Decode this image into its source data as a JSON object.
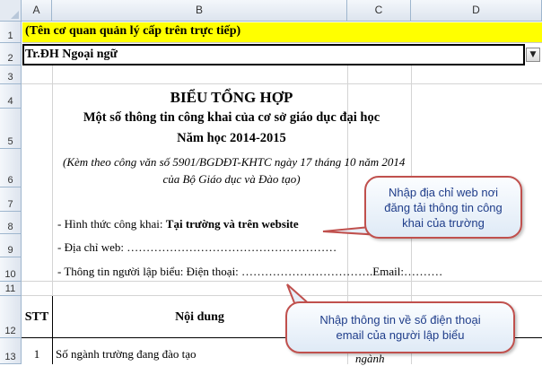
{
  "columns": [
    "A",
    "B",
    "C",
    "D"
  ],
  "rows": [
    "1",
    "2",
    "3",
    "4",
    "5",
    "6",
    "7",
    "8",
    "9",
    "10",
    "11",
    "12",
    "13"
  ],
  "row1": {
    "text": "(Tên cơ quan quản lý cấp trên trực tiếp)",
    "fill": "#ffff00"
  },
  "row2": {
    "text": "Tr.ĐH  Ngoại ngữ"
  },
  "title": {
    "heading": "BIỂU TỔNG HỢP",
    "subheading": "Một số thông tin công khai của cơ sở giáo dục đại học",
    "year": "Năm học 2014-2015",
    "note_line1": "(Kèm theo công văn số 5901/BGDĐT-KHTC  ngày 17 tháng 10 năm 2014",
    "note_line2": "của Bộ Giáo dục và Đào tạo)"
  },
  "form": {
    "publication_prefix": "- Hình thức công khai: ",
    "publication_value": "Tại trường và trên website",
    "address_label": "- Địa chỉ web: ………………………………………………",
    "creator_label": "- Thông tin người lập biểu:  Điện thoại: …………………………….Email:…………………"
  },
  "table": {
    "header_stt": "STT",
    "header_content": "Nội dung",
    "row1_stt": "1",
    "row1_content": "Số ngành trường đang đào tạo",
    "row1_unit": "ngành"
  },
  "callouts": {
    "web": "Nhập địa chỉ web nơi đăng tải thông tin công khai của trường",
    "contact": "Nhập thông tin về số điện thoại email của người lập biểu"
  }
}
